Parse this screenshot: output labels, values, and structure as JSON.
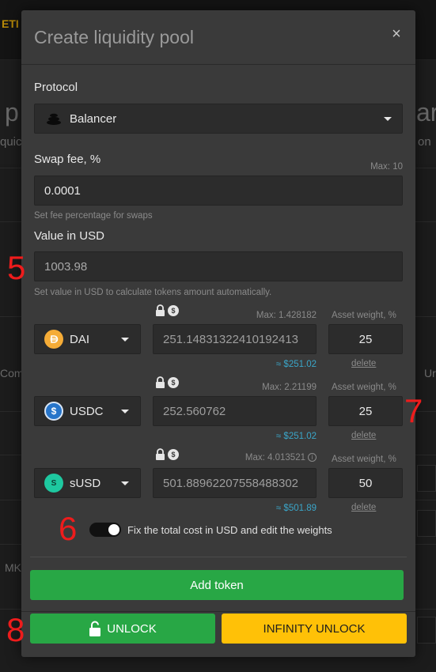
{
  "background": {
    "logo_text": "ETI",
    "hero_left": "p",
    "hero_right": "ar",
    "hero_small_left": "quic",
    "hero_small_right": "on",
    "side_left_1": "Com",
    "side_right_1": "Ur",
    "side_left_2": "MK"
  },
  "modal": {
    "title": "Create liquidity pool",
    "close_symbol": "×"
  },
  "protocol": {
    "label": "Protocol",
    "selected": "Balancer"
  },
  "swap_fee": {
    "label": "Swap fee, %",
    "max": "Max: 10",
    "value": "0.0001",
    "hint": "Set fee percentage for swaps"
  },
  "value_usd": {
    "label": "Value in USD",
    "value": "1003.98",
    "hint": "Set value in USD to calculate tokens amount automatically."
  },
  "tokens": [
    {
      "symbol": "DAI",
      "icon": "dai-icon",
      "color": "#f5ac37",
      "max": "Max: 1.428182",
      "amount": "251.14831322410192413",
      "weight_label": "Asset weight, %",
      "weight": "25",
      "usd": "≈ $251.02",
      "delete": "delete"
    },
    {
      "symbol": "USDC",
      "icon": "usdc-icon",
      "color": "#2775ca",
      "max": "Max: 2.21199",
      "amount": "252.560762",
      "weight_label": "Asset weight, %",
      "weight": "25",
      "usd": "≈ $251.02",
      "delete": "delete"
    },
    {
      "symbol": "sUSD",
      "icon": "susd-icon",
      "color": "#1ec8a0",
      "max": "Max: 4.013521",
      "amount": "501.88962207558488302",
      "weight_label": "Asset weight, %",
      "weight": "50",
      "usd": "≈ $501.89",
      "delete": "delete"
    }
  ],
  "toggle": {
    "label": "Fix the total cost in USD and edit the weights",
    "state": "on"
  },
  "buttons": {
    "add_token": "Add token",
    "unlock": "UNLOCK",
    "infinity_unlock": "INFINITY UNLOCK"
  },
  "annotations": {
    "a5": "5",
    "a6": "6",
    "a7": "7",
    "a8": "8"
  },
  "colors": {
    "accent_green": "#28a745",
    "accent_yellow": "#ffc107",
    "usd_blue": "#3aa6c9",
    "annotation_red": "#ee1c1c"
  }
}
